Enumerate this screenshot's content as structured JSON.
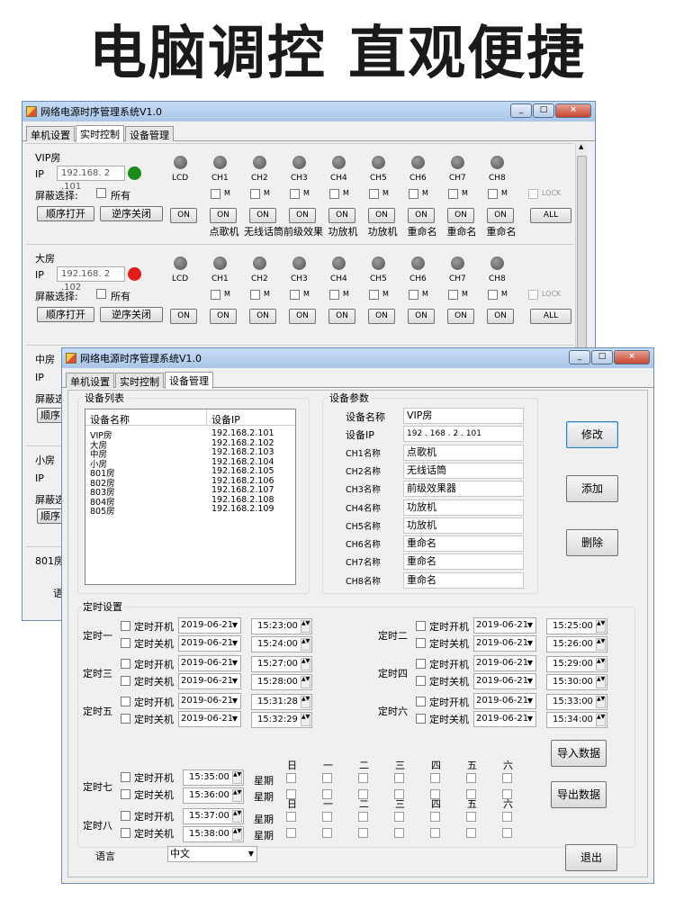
{
  "headline": "电脑调控 直观便捷",
  "app_title": "网络电源时序管理系统V1.0",
  "win_buttons": {
    "min": "_",
    "max": "□",
    "close": "×"
  },
  "tabs": [
    "单机设置",
    "实时控制",
    "设备管理"
  ],
  "rt": {
    "ip_label": "IP",
    "mask_label": "屏蔽选择:",
    "all_label": "所有",
    "seq_on": "顺序打开",
    "seq_off": "逆序关闭",
    "on": "ON",
    "all": "ALL",
    "m": "M",
    "lock": "LOCK",
    "channels": [
      "LCD",
      "CH1",
      "CH2",
      "CH3",
      "CH4",
      "CH5",
      "CH6",
      "CH7",
      "CH8"
    ],
    "rooms": [
      {
        "name": "VIP房",
        "ip": "192.168. 2 .101",
        "status": "online",
        "status_color": "#1a8a1a",
        "channel_names": [
          "点歌机",
          "无线话筒",
          "前级效果",
          "功放机",
          "功放机",
          "重命名",
          "重命名",
          "重命名"
        ]
      },
      {
        "name": "大房",
        "ip": "192.168. 2 .102",
        "status": "offline",
        "status_color": "#e81b1b"
      },
      {
        "name": "中房"
      },
      {
        "name": "小房"
      },
      {
        "name": "801房"
      }
    ],
    "partial": {
      "ip": "IP",
      "mask": "屏蔽选",
      "seq": "顺序",
      "lang": "语"
    }
  },
  "dm": {
    "list_title": "设备列表",
    "col_name": "设备名称",
    "col_ip": "设备IP",
    "devices": [
      {
        "name": "VIP房",
        "ip": "192.168.2.101"
      },
      {
        "name": "大房",
        "ip": "192.168.2.102"
      },
      {
        "name": "中房",
        "ip": "192.168.2.103"
      },
      {
        "name": "小房",
        "ip": "192.168.2.104"
      },
      {
        "name": "801房",
        "ip": "192.168.2.105"
      },
      {
        "name": "802房",
        "ip": "192.168.2.106"
      },
      {
        "name": "803房",
        "ip": "192.168.2.107"
      },
      {
        "name": "804房",
        "ip": "192.168.2.108"
      },
      {
        "name": "805房",
        "ip": "192.168.2.109"
      }
    ],
    "param_title": "设备参数",
    "params": [
      {
        "label": "设备名称",
        "value": "VIP房"
      },
      {
        "label": "设备IP",
        "value": "192 . 168 .  2  . 101"
      },
      {
        "label": "CH1名称",
        "value": "点歌机"
      },
      {
        "label": "CH2名称",
        "value": "无线话筒"
      },
      {
        "label": "CH3名称",
        "value": "前级效果器"
      },
      {
        "label": "CH4名称",
        "value": "功放机"
      },
      {
        "label": "CH5名称",
        "value": "功放机"
      },
      {
        "label": "CH6名称",
        "value": "重命名"
      },
      {
        "label": "CH7名称",
        "value": "重命名"
      },
      {
        "label": "CH8名称",
        "value": "重命名"
      }
    ],
    "btn_modify": "修改",
    "btn_add": "添加",
    "btn_delete": "删除",
    "timer_title": "定时设置",
    "on_label": "定时开机",
    "off_label": "定时关机",
    "timers": [
      {
        "name": "定时一",
        "on_date": "2019-06-21",
        "on_time": "15:23:00",
        "off_date": "2019-06-21",
        "off_time": "15:24:00"
      },
      {
        "name": "定时二",
        "on_date": "2019-06-21",
        "on_time": "15:25:00",
        "off_date": "2019-06-21",
        "off_time": "15:26:00"
      },
      {
        "name": "定时三",
        "on_date": "2019-06-21",
        "on_time": "15:27:00",
        "off_date": "2019-06-21",
        "off_time": "15:28:00"
      },
      {
        "name": "定时四",
        "on_date": "2019-06-21",
        "on_time": "15:29:00",
        "off_date": "2019-06-21",
        "off_time": "15:30:00"
      },
      {
        "name": "定时五",
        "on_date": "2019-06-21",
        "on_time": "15:31:28",
        "off_date": "2019-06-21",
        "off_time": "15:32:29"
      },
      {
        "name": "定时六",
        "on_date": "2019-06-21",
        "on_time": "15:33:00",
        "off_date": "2019-06-21",
        "off_time": "15:34:00"
      }
    ],
    "weekly": [
      {
        "name": "定时七",
        "on_time": "15:35:00",
        "off_time": "15:36:00"
      },
      {
        "name": "定时八",
        "on_time": "15:37:00",
        "off_time": "15:38:00"
      }
    ],
    "week_label": "星期",
    "days": [
      "日",
      "一",
      "二",
      "三",
      "四",
      "五",
      "六"
    ],
    "btn_import": "导入数据",
    "btn_export": "导出数据",
    "lang_label": "语言",
    "lang_value": "中文",
    "btn_exit": "退出"
  }
}
